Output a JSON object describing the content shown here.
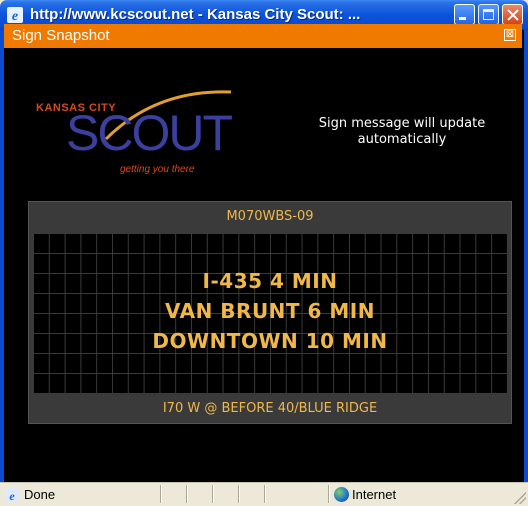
{
  "window": {
    "title": "http://www.kcscout.net - Kansas City Scout: ...",
    "icon": "ie-icon"
  },
  "panel": {
    "title": "Sign Snapshot",
    "close_glyph": "⊠"
  },
  "logo": {
    "top_text": "KANSAS CITY",
    "main_text": "SCOUT",
    "tagline": "getting you there"
  },
  "update_message": "Sign message will update automatically",
  "sign": {
    "id": "M070WBS-09",
    "lines": [
      "I-435 4 MIN",
      "VAN BRUNT 6 MIN",
      "DOWNTOWN 10 MIN"
    ],
    "location": "I70 W @ BEFORE 40/BLUE RIDGE",
    "text_color": "#f0b84a"
  },
  "status_bar": {
    "status_text": "Done",
    "zone": "Internet",
    "zone_icon": "globe-icon"
  },
  "colors": {
    "titlebar": "#0a53da",
    "panel_header": "#f07a00",
    "background": "#000000"
  }
}
